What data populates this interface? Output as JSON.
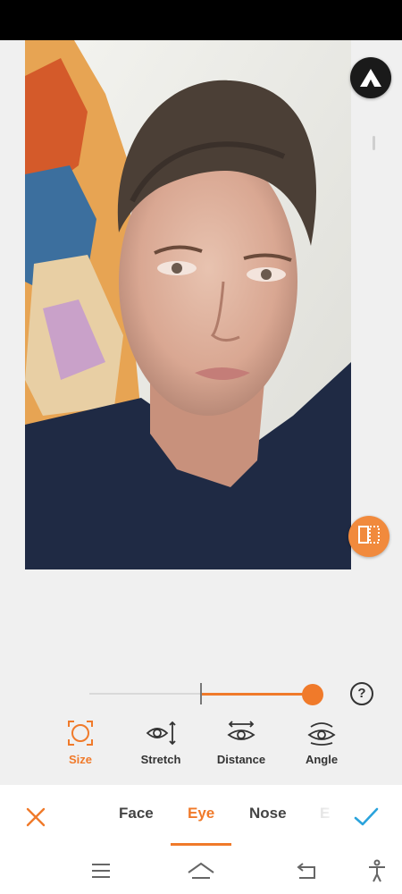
{
  "app": {
    "accent_color": "#f07a2a",
    "logo_icon": "airbrush-logo-icon",
    "compare_icon": "compare-split-icon"
  },
  "adjust": {
    "slider_value_fraction": 1.0,
    "help_label": "?",
    "tools": [
      {
        "id": "size",
        "label": "Size",
        "icon": "size-frame-icon",
        "selected": true
      },
      {
        "id": "stretch",
        "label": "Stretch",
        "icon": "eye-stretch-icon",
        "selected": false
      },
      {
        "id": "distance",
        "label": "Distance",
        "icon": "eye-distance-icon",
        "selected": false
      },
      {
        "id": "angle",
        "label": "Angle",
        "icon": "eye-angle-icon",
        "selected": false
      }
    ]
  },
  "bottom_bar": {
    "cancel_icon": "close-icon",
    "confirm_icon": "checkmark-icon",
    "tabs": [
      {
        "label": "Face",
        "active": false
      },
      {
        "label": "Eye",
        "active": true
      },
      {
        "label": "Nose",
        "active": false
      },
      {
        "label": "E",
        "active": false
      }
    ]
  },
  "nav": {
    "items": [
      "menu-icon",
      "home-icon",
      "back-icon",
      "accessibility-icon"
    ]
  }
}
